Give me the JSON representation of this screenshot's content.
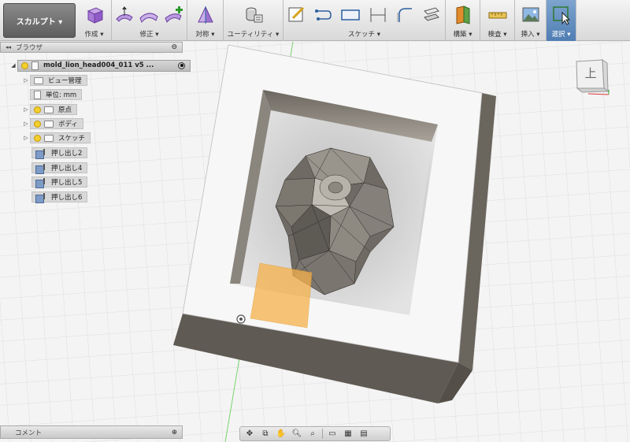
{
  "toolbar": {
    "workspace_label": "スカルプト ▾",
    "groups": [
      {
        "label": "作成 ▾"
      },
      {
        "label": "修正 ▾"
      },
      {
        "label": "対称 ▾"
      },
      {
        "label": "ユーティリティ ▾"
      },
      {
        "label": "スケッチ ▾"
      },
      {
        "label": "構築 ▾"
      },
      {
        "label": "検査 ▾"
      },
      {
        "label": "挿入 ▾"
      },
      {
        "label": "選択 ▾"
      }
    ]
  },
  "browser": {
    "title": "ブラウザ",
    "root": "mold_lion_head004_011 v5 ...",
    "items": [
      {
        "label": "ビュー管理"
      },
      {
        "label": "単位: mm"
      },
      {
        "label": "原点"
      },
      {
        "label": "ボディ"
      },
      {
        "label": "スケッチ"
      },
      {
        "label": "押し出し2"
      },
      {
        "label": "押し出し4"
      },
      {
        "label": "押し出し5"
      },
      {
        "label": "押し出し6"
      }
    ]
  },
  "viewcube": {
    "face_label": "上"
  },
  "comments": {
    "label": "コメント"
  },
  "icons": {
    "collapse": "double-left-arrow-icon",
    "tree_expand": "triangle-right-icon",
    "visibility": "lightbulb-icon",
    "folder": "folder-icon",
    "extrude": "extrude-feature-icon"
  },
  "colors": {
    "accent": "#3b6ea8",
    "toolbar_bg": "#dcdcdc",
    "mold_wall": "#5a554e",
    "sketch_fill": "#f6b24b"
  }
}
